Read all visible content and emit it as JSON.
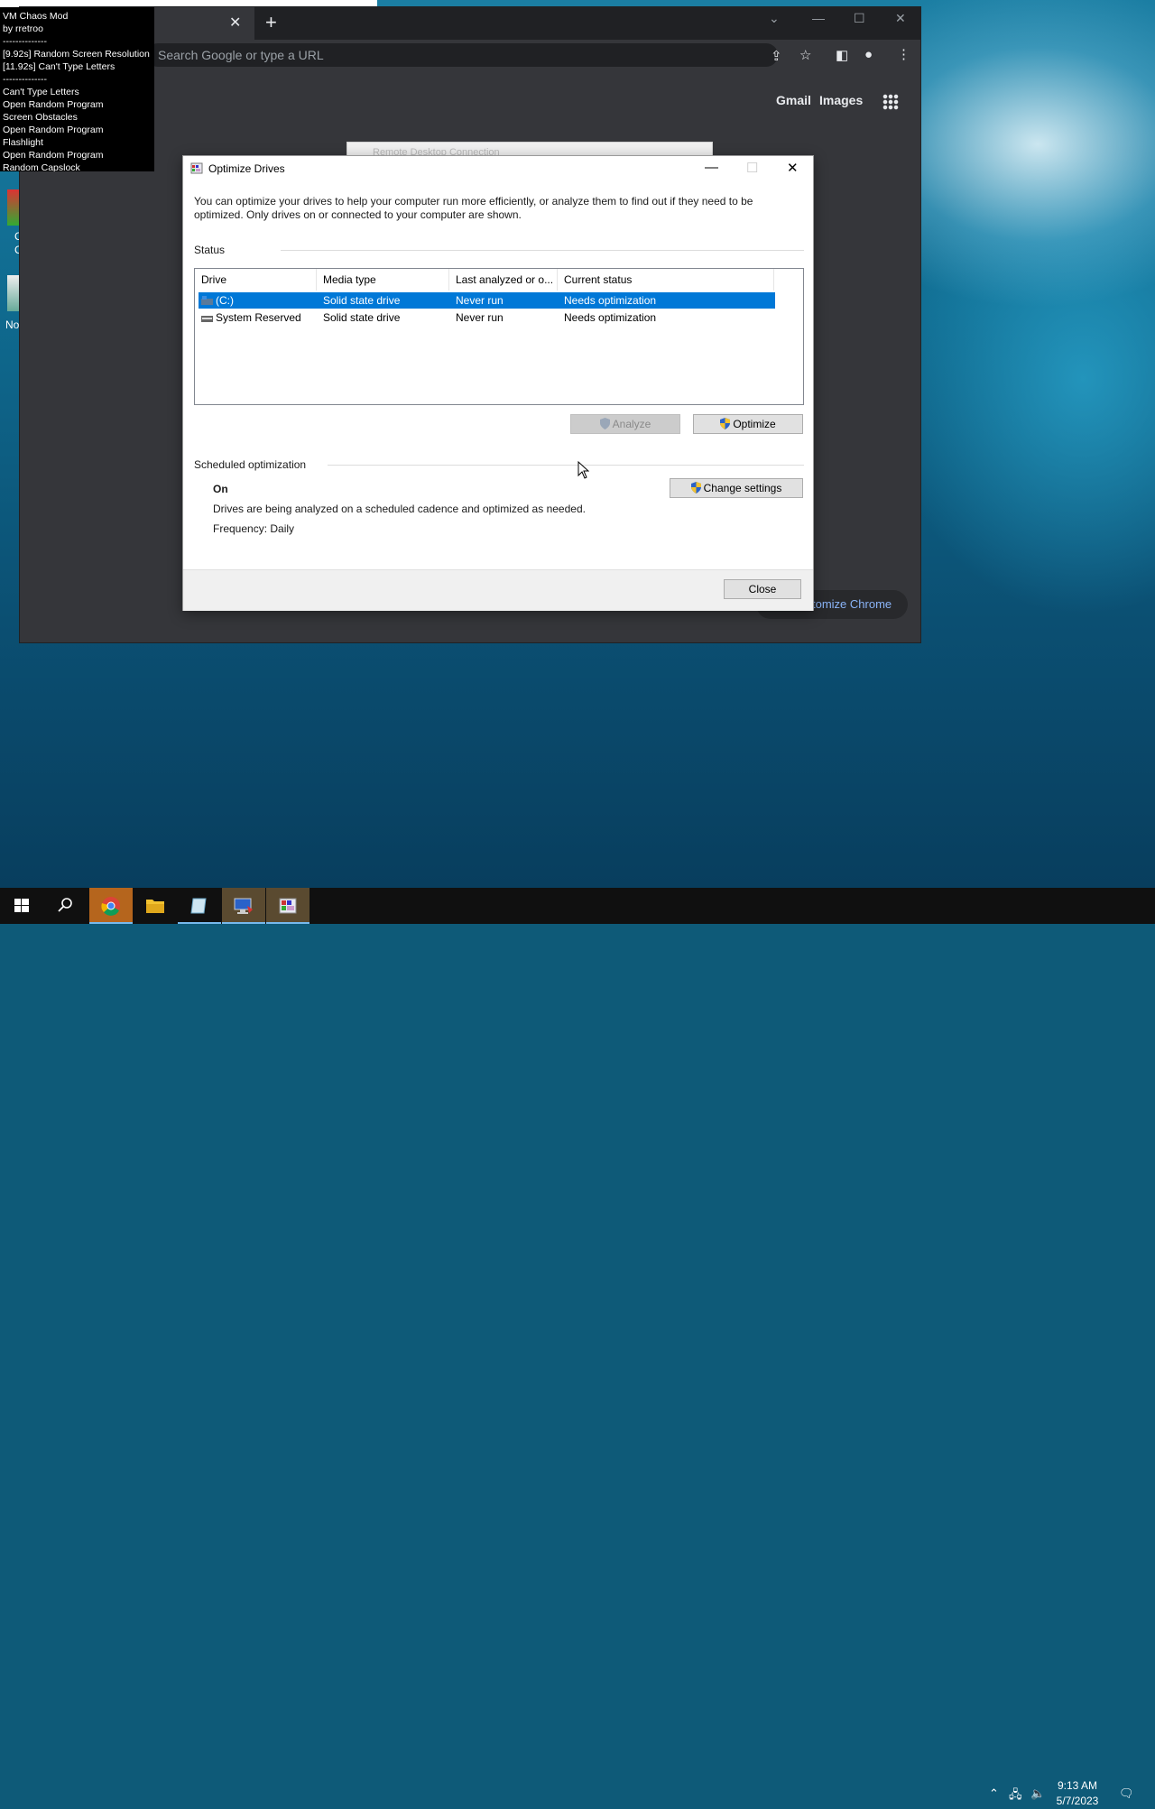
{
  "chaos_mod": {
    "lines": [
      "VM Chaos Mod",
      "by rretroo",
      "--------------",
      "[9.92s] Random Screen Resolution",
      "[11.92s] Can't Type Letters",
      "--------------",
      "Can't Type Letters",
      "Open Random Program",
      "Screen Obstacles",
      "Open Random Program",
      "Flashlight",
      "Open Random Program",
      "Random Capslock"
    ]
  },
  "chrome": {
    "omnibox_placeholder": "Search Google or type a URL",
    "gmail_link": "Gmail",
    "images_link": "Images",
    "customize_label": "Customize Chrome",
    "customize_visible": "tomize Chrome"
  },
  "rdp_window": {
    "title": "Remote Desktop Connection"
  },
  "desktop_icons": {
    "label_partial_1": "C",
    "label_partial_2": "C",
    "label_partial_3": "No"
  },
  "dialog": {
    "title": "Optimize Drives",
    "intro": "You can optimize your drives to help your computer run more efficiently, or analyze them to find out if they need to be optimized. Only drives on or connected to your computer are shown.",
    "status_label": "Status",
    "columns": [
      "Drive",
      "Media type",
      "Last analyzed or o...",
      "Current status"
    ],
    "rows": [
      {
        "drive": "(C:)",
        "media": "Solid state drive",
        "last": "Never run",
        "status": "Needs optimization",
        "selected": true
      },
      {
        "drive": "System Reserved",
        "media": "Solid state drive",
        "last": "Never run",
        "status": "Needs optimization",
        "selected": false
      }
    ],
    "analyze_button": "Analyze",
    "optimize_button": "Optimize",
    "scheduled_label": "Scheduled optimization",
    "schedule_state": "On",
    "schedule_desc": "Drives are being analyzed on a scheduled cadence and optimized as needed.",
    "frequency": "Frequency: Daily",
    "change_settings_button": "Change settings",
    "close_button": "Close"
  },
  "taskbar": {
    "time": "9:13 AM",
    "date": "5/7/2023"
  },
  "colors": {
    "selection": "#0078d7",
    "chrome_dark": "#35363a",
    "taskbar": "#101010"
  }
}
